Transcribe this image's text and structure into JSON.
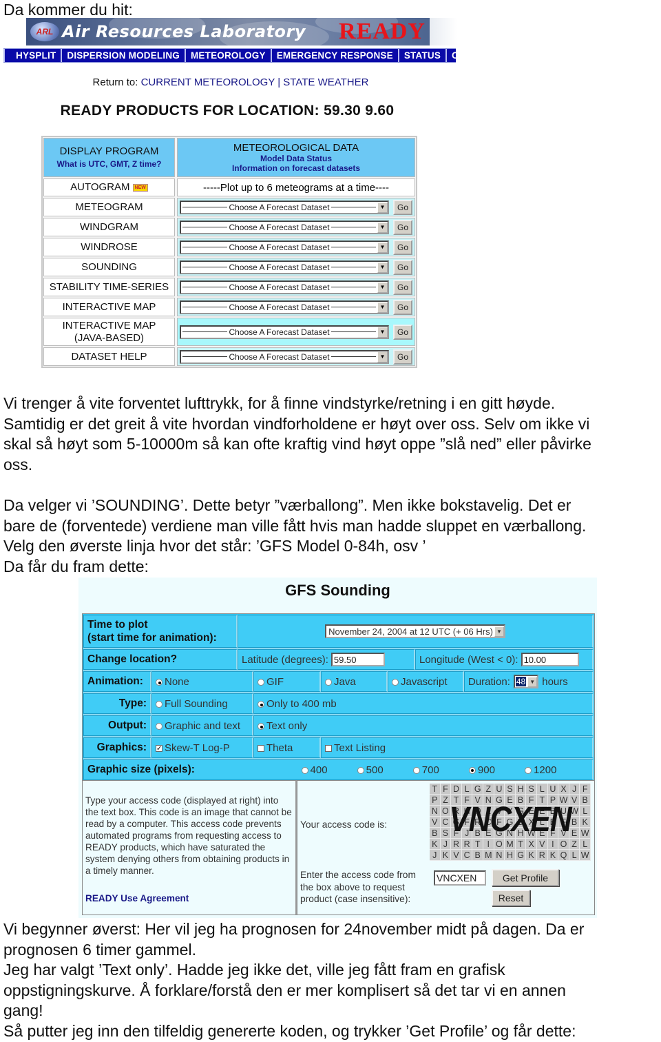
{
  "intro": {
    "line1": "Da kommer du hit:"
  },
  "ready_page": {
    "banner": {
      "logo_text": "ARL",
      "title": "Air Resources Laboratory",
      "brand": "READY"
    },
    "nav": [
      "HYSPLIT",
      "DISPERSION MODELING",
      "METEOROLOGY",
      "EMERGENCY RESPONSE",
      "STATUS",
      "CONT"
    ],
    "return_to": {
      "label": "Return to: ",
      "link1": "CURRENT METEOROLOGY",
      "separator": " | ",
      "link2": "STATE WEATHER"
    },
    "heading": "READY PRODUCTS FOR LOCATION: 59.30 9.60",
    "table": {
      "header_left_title": "DISPLAY PROGRAM",
      "header_left_link": "What is UTC, GMT, Z time?",
      "header_right_title": "METEOROLOGICAL DATA",
      "header_right_link1": "Model Data Status",
      "header_right_link2": "Information on forecast datasets",
      "autogram": {
        "label": "AUTOGRAM",
        "badge": "NEW",
        "link": "-----Plot up to 6 meteograms at a time----"
      },
      "rows": [
        {
          "label": "METEOGRAM",
          "select": "Choose A Forecast Dataset",
          "go": "Go"
        },
        {
          "label": "WINDGRAM",
          "select": "Choose A Forecast Dataset",
          "go": "Go"
        },
        {
          "label": "WINDROSE",
          "select": "Choose A Forecast Dataset",
          "go": "Go"
        },
        {
          "label": "SOUNDING",
          "select": "Choose A Forecast Dataset",
          "go": "Go"
        },
        {
          "label": "STABILITY TIME-SERIES",
          "select": "Choose A Forecast Dataset",
          "go": "Go"
        },
        {
          "label": "INTERACTIVE MAP",
          "select": "Choose A Forecast Dataset",
          "go": "Go"
        },
        {
          "label": "INTERACTIVE MAP (JAVA-BASED)",
          "label_line1": "INTERACTIVE MAP",
          "label_line2": "(JAVA-BASED)",
          "select": "Choose A Forecast Dataset",
          "go": "Go"
        },
        {
          "label": "DATASET HELP",
          "select": "Choose A Forecast Dataset",
          "go": "Go"
        }
      ]
    }
  },
  "paragraph1": [
    "Vi trenger å vite forventet lufttrykk, for å finne vindstyrke/retning i en gitt høyde.",
    "Samtidig er det greit å vite hvordan vindforholdene er høyt over oss. Selv om ikke vi",
    "skal så høyt som 5-10000m så kan ofte kraftig vind høyt oppe ”slå ned” eller påvirke",
    "oss."
  ],
  "paragraph2": [
    "Da velger vi ’SOUNDING’. Dette betyr ”værballong”. Men ikke bokstavelig. Det er",
    "bare de (forventede) verdiene man ville fått hvis man hadde sluppet en værballong.",
    "Velg den øverste linja hvor det står: ’GFS Model 0-84h, osv  ’",
    "Da får du fram dette:"
  ],
  "gfs_page": {
    "title": "GFS Sounding",
    "time_label_line1": "Time to plot",
    "time_label_line2": "(start time for animation):",
    "time_value": "November 24, 2004 at 12 UTC (+ 06 Hrs)",
    "location_label": "Change location?",
    "latitude_label": "Latitude (degrees):",
    "latitude_value": "59.50",
    "longitude_label": "Longitude (West < 0):",
    "longitude_value": "10.00",
    "animation": {
      "label": "Animation:",
      "options": [
        {
          "label": "None",
          "selected": true
        },
        {
          "label": "GIF",
          "selected": false
        },
        {
          "label": "Java",
          "selected": false
        },
        {
          "label": "Javascript",
          "selected": false
        }
      ],
      "duration_label": "Duration:",
      "duration_value": "48",
      "duration_unit": "hours"
    },
    "type": {
      "label": "Type:",
      "options": [
        {
          "label": "Full Sounding",
          "selected": false
        },
        {
          "label": "Only to 400 mb",
          "selected": true
        }
      ]
    },
    "output": {
      "label": "Output:",
      "options": [
        {
          "label": "Graphic and text",
          "selected": false
        },
        {
          "label": "Text only",
          "selected": true
        }
      ]
    },
    "graphics": {
      "label": "Graphics:",
      "options": [
        {
          "label": "Skew-T Log-P",
          "checked": true
        },
        {
          "label": "Theta",
          "checked": false
        },
        {
          "label": "Text Listing",
          "checked": false
        }
      ]
    },
    "graphic_size": {
      "label": "Graphic size (pixels):",
      "options": [
        {
          "label": "400",
          "selected": false
        },
        {
          "label": "500",
          "selected": false
        },
        {
          "label": "700",
          "selected": false
        },
        {
          "label": "900",
          "selected": true
        },
        {
          "label": "1200",
          "selected": false
        }
      ]
    },
    "access": {
      "explanation": "Type your access code (displayed at right) into the text box. This code is an image that cannot be read by a computer. This access code prevents automated programs from requesting access to READY products, which have saturated the system denying others from obtaining products in a timely manner.",
      "agreement_link": "READY Use Agreement",
      "code_label": "Your access code is:",
      "captcha_code": "VNCXEN",
      "captcha_grid": [
        "TFDLGZUSHSLUXJF",
        "PZTFVNGEBFTPWVB",
        "NORHOLVYGEEBUWL",
        "VCGFRCFGDXLEFBK",
        "BSFJBEGNHWEFVEW",
        "KJRRTIOMTXVIOZL",
        "JKVCBMNHGKRKQLW"
      ],
      "enter_label_line1": "Enter the access code from",
      "enter_label_line2": "the box above to request",
      "enter_label_line3": "product (case insensitive):",
      "code_input_value": "VNCXEN",
      "get_profile_button": "Get Profile",
      "reset_button": "Reset"
    }
  },
  "paragraph3": [
    "Vi begynner øverst: Her vil jeg ha prognosen for 24november midt på dagen. Da er",
    "prognosen 6 timer gammel.",
    "Jeg har valgt  ’Text only’. Hadde jeg ikke det, ville jeg fått fram en grafisk",
    "oppstigningskurve. Å forklare/forstå den er mer komplisert så det tar vi en annen",
    "gang!",
    "Så putter jeg inn den tilfeldig genererte koden, og trykker ’Get Profile’ og får dette:"
  ]
}
